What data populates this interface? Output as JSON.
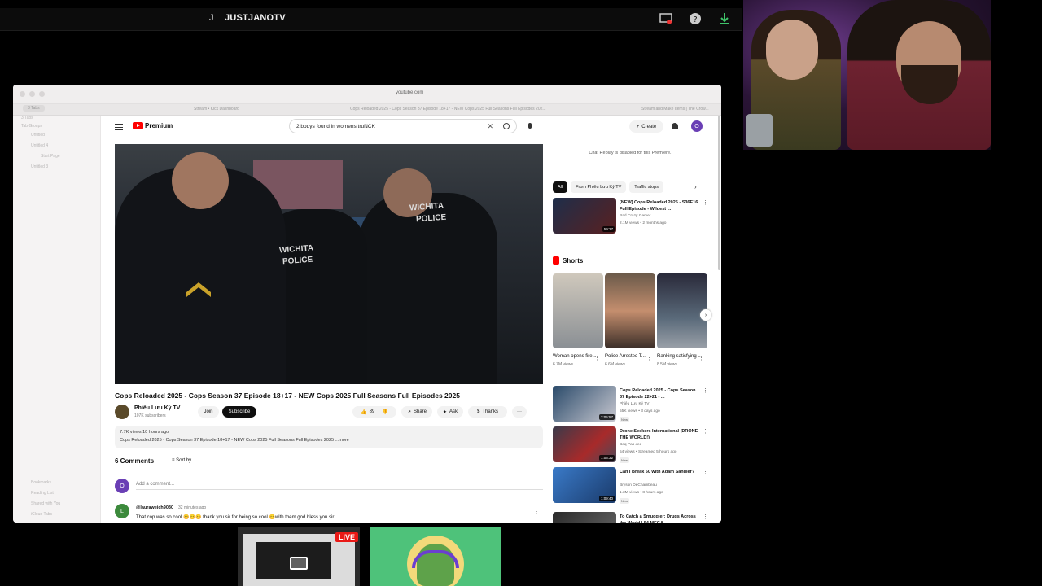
{
  "stream": {
    "initial": "J",
    "channel": "JUSTJANOTV"
  },
  "browser": {
    "url": "youtube.com",
    "tabs": [
      "3 Tabs",
      "Stream • Kick Dashboard",
      "Cops Reloaded 2025 - Cops Season 37 Episode 18+17 - NEW Cops 2025 Full Seasons Full Episodes 202...",
      "Stream and Make Items | The Crow..."
    ],
    "sidebar": [
      "3 Tabs",
      "Tab Groups",
      "Untitled",
      "Untitled 4",
      "Start Page",
      "Untitled 3",
      "Bookmarks",
      "Reading List",
      "Shared with You",
      "iCloud Tabs"
    ]
  },
  "youtube": {
    "brand": "Premium",
    "search_query": "2 bodys found in womens truNCK",
    "create_label": "Create",
    "avatar_letter": "O",
    "video_title": "Cops Reloaded 2025 - Cops Season 37 Episode 18+17 - NEW Cops 2025 Full Seasons Full Episodes 2025",
    "overlay_text_1": "WICHITA",
    "overlay_text_2": "POLICE",
    "channel_name": "Phiêu Lưu Ký TV",
    "channel_subs": "107K subscribers",
    "join_label": "Join",
    "subscribe_label": "Subscribe",
    "likes": "89",
    "share_label": "Share",
    "ask_label": "Ask",
    "thanks_label": "Thanks",
    "desc_line1": "7.7K views  10 hours ago",
    "desc_line2": "Cops Reloaded 2025 - Cops Season 37 Episode 18+17 - NEW Cops 2025 Full Seasons Full Episodes 2025 ...more",
    "comments_header": "6 Comments",
    "sort_label": "Sort by",
    "add_comment": "Add a comment...",
    "comment": {
      "avatar": "L",
      "user": "@lauraweich9030",
      "time": "32 minutes ago",
      "text": "That cop was so cool 😊😊😊 thank you sir for being so cool 😊with them god bless you sir"
    },
    "chat_replay": "Chat Replay is disabled for this Premiere.",
    "chips": [
      "All",
      "From Phiêu Lưu Ký TV",
      "Traffic stops"
    ],
    "rec_top": {
      "title": "[NEW] Cops Reloaded 2025 - S36E16 Full Episode - Wildest ...",
      "channel": "Bad Crazy Gamer",
      "meta": "2.1M views • 2 months ago",
      "duration": "59:27"
    },
    "shorts_label": "Shorts",
    "shorts": [
      {
        "title": "Woman opens fire ...",
        "views": "6.7M views"
      },
      {
        "title": "Police Arrested T...",
        "views": "6.6M views"
      },
      {
        "title": "Ranking satisfying ...",
        "views": "8.5M views"
      }
    ],
    "recs": [
      {
        "title": "Cops Reloaded 2025 - Cops Season 37 Episode 22+21 - ...",
        "channel": "Phiêu Lưu Ký TV",
        "meta": "55K views • 3 days ago",
        "badge": "New",
        "duration": "2:05:57"
      },
      {
        "title": "Drone Seekers International (DRONE THE WORLD!)",
        "channel": "Beq Pas Jeq",
        "meta": "54 views • Streamed 5 hours ago",
        "badge": "New",
        "duration": "1:03:32"
      },
      {
        "title": "Can I Break 50 with Adam Sandler?",
        "channel": "Bryson DeChambeau",
        "meta": "1.3M views • 8 hours ago",
        "badge": "New",
        "duration": "1:09:40"
      },
      {
        "title": "To Catch a Smuggler: Drugs Across the World | 54 MEGA",
        "channel": "",
        "meta": "",
        "badge": "",
        "duration": ""
      }
    ]
  },
  "tiles": {
    "live_label": "LIVE"
  },
  "colors": {
    "yt_red": "#ff0000",
    "live_red": "#e91916",
    "accent_green": "#4ec27a"
  }
}
